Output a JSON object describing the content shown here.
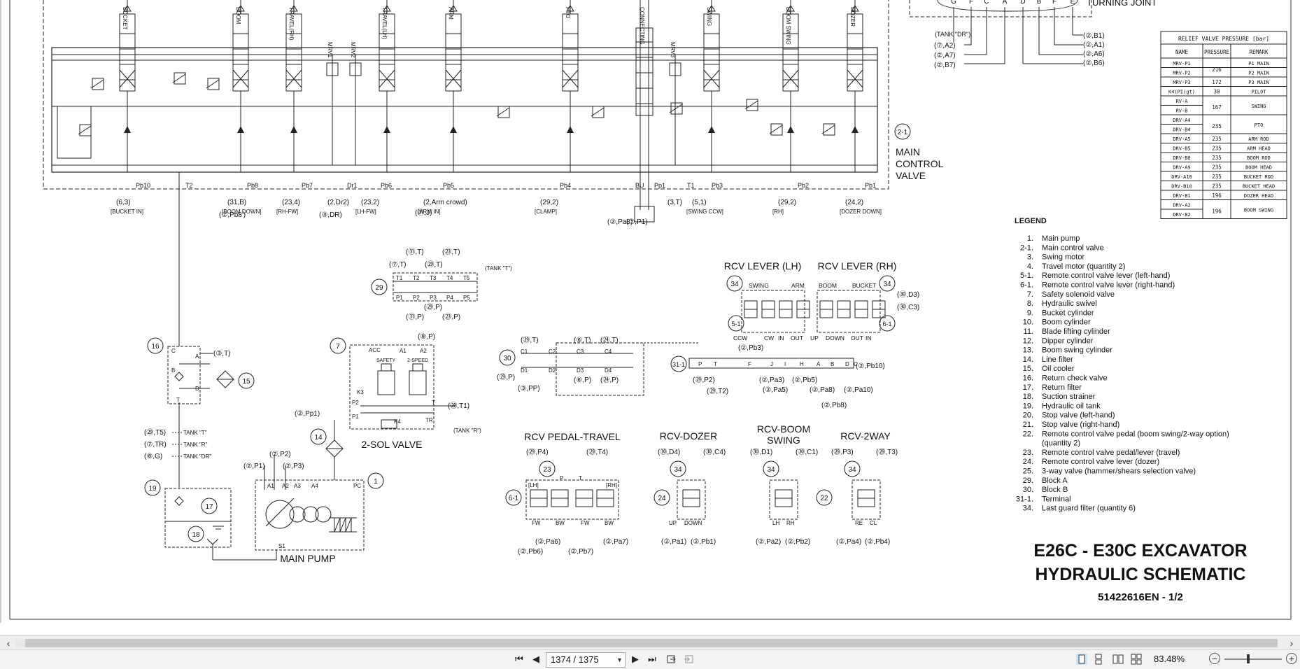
{
  "document": {
    "title_line1": "E26C - E30C EXCAVATOR",
    "title_line2": "HYDRAULIC SCHEMATIC",
    "doc_code": "51422616EN - 1/2"
  },
  "section_labels": {
    "main_control_valve_num": "2-1",
    "main_control_valve_1": "MAIN",
    "main_control_valve_2": "CONTROL",
    "main_control_valve_3": "VALVE",
    "turning_joint": "TURNING JOINT",
    "tank_dr": "(TANK \"DR\")",
    "rcv_lever_lh": "RCV LEVER (LH)",
    "rcv_lever_rh": "RCV LEVER (RH)",
    "rcv_pedal_travel": "RCV PEDAL-TRAVEL",
    "rcv_dozer": "RCV-DOZER",
    "rcv_boom_swing_1": "RCV-BOOM",
    "rcv_boom_swing_2": "SWING",
    "rcv_2way": "RCV-2WAY",
    "sol_valve": "2-SOL VALVE",
    "main_pump": "MAIN PUMP",
    "tank_t": "TANK \"T\"",
    "tank_r": "TANK \"R\"",
    "tank_dr2": "TANK \"DR\"",
    "tank_t_paren": "(TANK \"T\")",
    "tank_r_paren": "(TANK \"R\")",
    "safety": "SAFETY",
    "two_speed": "2-SPEED",
    "acc": "ACC"
  },
  "valve_sections": [
    "BUCKET",
    "BOOM",
    "TRAVEL(RH)",
    "MRV1",
    "MRV2",
    "TRAVEL(LH)",
    "ARM",
    "PTO",
    "CONNECTING",
    "MRV3",
    "SWING",
    "BOOM SWING",
    "DOZER"
  ],
  "ports_bottom": [
    {
      "port": "Pb10",
      "ref": "6",
      "n": "3",
      "desc": "[BUCKET IN]"
    },
    {
      "port": "T2",
      "ref": "",
      "n": "",
      "desc": ""
    },
    {
      "port": "Pb8",
      "ref": "31",
      "n": "B",
      "desc": "[BOOM DOWN]",
      "extra": "(②,Pb8')"
    },
    {
      "port": "Pb7",
      "ref": "23",
      "n": "4",
      "desc": "[RH-FW]"
    },
    {
      "port": "Dr1",
      "ref": "2",
      "n": "Dr2",
      "desc": "",
      "extra": "(③,DR)"
    },
    {
      "port": "Pb6",
      "ref": "23",
      "n": "2",
      "desc": "[LH-FW]"
    },
    {
      "port": "Pb5",
      "ref": "2",
      "n": "Arm crowd",
      "desc": "[ARM IN]",
      "extra": "(㉛,J)"
    },
    {
      "port": "Pb4",
      "ref": "29",
      "n": "2",
      "desc": "[CLAMP]"
    },
    {
      "port": "BU",
      "ref": "",
      "n": "",
      "desc": "",
      "extra": "(②,Pa8)"
    },
    {
      "port": "Pp1",
      "ref": "",
      "n": "",
      "desc": "",
      "extra": "(⑦,P1)"
    },
    {
      "port": "T1",
      "ref": "3",
      "n": "T",
      "desc": ""
    },
    {
      "port": "Pb3",
      "ref": "5",
      "n": "1",
      "desc": "[SWING CCW]"
    },
    {
      "port": "Pb2",
      "ref": "29",
      "n": "2",
      "desc": "[RH]"
    },
    {
      "port": "Pb1",
      "ref": "24",
      "n": "2",
      "desc": "[DOZER DOWN]"
    }
  ],
  "relief_table": {
    "title": "RELIEF VALVE PRESSURE [bar]",
    "headers": [
      "NAME",
      "PRESSURE",
      "REMARK"
    ],
    "rows": [
      {
        "name": "MRV-P1",
        "pressure": "216",
        "remark": "P1 MAIN"
      },
      {
        "name": "MRV-P2",
        "pressure": "",
        "remark": "P2 MAIN"
      },
      {
        "name": "MRV-P3",
        "pressure": "172",
        "remark": "P3 MAIN"
      },
      {
        "name": "K4(PI(gt)",
        "pressure": "30",
        "remark": "PILOT"
      },
      {
        "name": "RV-A",
        "pressure": "167",
        "remark": "SWING"
      },
      {
        "name": "RV-B",
        "pressure": "",
        "remark": ""
      },
      {
        "name": "DRV-A4",
        "pressure": "235",
        "remark": "PTO"
      },
      {
        "name": "DRV-B4",
        "pressure": "",
        "remark": ""
      },
      {
        "name": "DRV-A5",
        "pressure": "235",
        "remark": "ARM ROD"
      },
      {
        "name": "DRV-B5",
        "pressure": "235",
        "remark": "ARM HEAD"
      },
      {
        "name": "DRV-B8",
        "pressure": "235",
        "remark": "BOOM ROD"
      },
      {
        "name": "DRV-A9",
        "pressure": "235",
        "remark": "BOOM HEAD"
      },
      {
        "name": "DRV-A10",
        "pressure": "235",
        "remark": "BUCKET ROD"
      },
      {
        "name": "DRV-B10",
        "pressure": "235",
        "remark": "BUCKET HEAD"
      },
      {
        "name": "DRV-B1",
        "pressure": "196",
        "remark": "DOZER HEAD"
      },
      {
        "name": "DRV-A2",
        "pressure": "196",
        "remark": "BOOM SWING"
      },
      {
        "name": "DRV-B2",
        "pressure": "",
        "remark": ""
      }
    ]
  },
  "legend": {
    "title": "LEGEND",
    "items": [
      {
        "num": "1.",
        "text": "Main pump"
      },
      {
        "num": "2-1.",
        "text": "Main control valve"
      },
      {
        "num": "3.",
        "text": "Swing motor"
      },
      {
        "num": "4.",
        "text": "Travel motor (quantity 2)"
      },
      {
        "num": "5-1.",
        "text": "Remote control valve lever (left-hand)"
      },
      {
        "num": "6-1.",
        "text": "Remote control valve lever (right-hand)"
      },
      {
        "num": "7.",
        "text": "Safety solenoid valve"
      },
      {
        "num": "8.",
        "text": "Hydraulic swivel"
      },
      {
        "num": "9.",
        "text": "Bucket cylinder"
      },
      {
        "num": "10.",
        "text": "Boom cylinder"
      },
      {
        "num": "11.",
        "text": "Blade lifting cylinder"
      },
      {
        "num": "12.",
        "text": "Dipper cylinder"
      },
      {
        "num": "13.",
        "text": "Boom swing cylinder"
      },
      {
        "num": "14.",
        "text": "Line filter"
      },
      {
        "num": "15.",
        "text": "Oil cooler"
      },
      {
        "num": "16.",
        "text": "Return check valve"
      },
      {
        "num": "17.",
        "text": "Return filter"
      },
      {
        "num": "18.",
        "text": "Suction strainer"
      },
      {
        "num": "19.",
        "text": "Hydraulic oil tank"
      },
      {
        "num": "20.",
        "text": "Stop valve (left-hand)"
      },
      {
        "num": "21.",
        "text": "Stop valve (right-hand)"
      },
      {
        "num": "22.",
        "text": "Remote control valve pedal (boom swing/2-way option)"
      },
      {
        "num": "",
        "text": "(quantity 2)"
      },
      {
        "num": "23.",
        "text": "Remote control valve pedal/lever (travel)"
      },
      {
        "num": "24.",
        "text": "Remote control valve lever (dozer)"
      },
      {
        "num": "25.",
        "text": "3-way valve (hammer/shears selection valve)"
      },
      {
        "num": "29.",
        "text": "Block A"
      },
      {
        "num": "30.",
        "text": "Block B"
      },
      {
        "num": "31-1.",
        "text": "Terminal"
      },
      {
        "num": "34.",
        "text": "Last guard filter (quantity 6)"
      }
    ]
  },
  "turning_joint_ports": [
    "G",
    "F",
    "C",
    "A",
    "D",
    "B",
    "F",
    "E"
  ],
  "turning_joint_left": [
    "(⑦,A2)",
    "(②,A7)",
    "(②,B7)"
  ],
  "turning_joint_right": [
    "(②,B1)",
    "(②,A1)",
    "(②,A6)",
    "(②,B6)"
  ],
  "component_numbers": [
    "29",
    "7",
    "16",
    "15",
    "14",
    "19",
    "17",
    "18",
    "1",
    "30",
    "31-1",
    "5-1",
    "6-1",
    "34",
    "23",
    "24",
    "22",
    "34",
    "34",
    "34",
    "34",
    "34"
  ],
  "misc_labels": {
    "pump_ports": [
      "A1",
      "A2",
      "A3",
      "A4",
      "PC",
      "S1"
    ],
    "pump_refs": [
      "(②,P1)",
      "(②,P2)",
      "(②,P3)"
    ],
    "sol_refs": [
      "(⑧,P)",
      "(②,Pp1)",
      "(㉙,T1)"
    ],
    "sol_ports": [
      "A1",
      "A2",
      "K3",
      "P2",
      "P1",
      "K4",
      "TR",
      "T"
    ],
    "block_a_refs": [
      "(㉛,T)",
      "(㉓,T)",
      "(⑦,T)",
      "(㉙,T)",
      "(㉙,P)",
      "(㉛,P)",
      "(㉓,P)"
    ],
    "block_a_ports": [
      "T1",
      "T2",
      "T3",
      "T4",
      "T5",
      "P1",
      "P2",
      "P3",
      "P4",
      "P5"
    ],
    "filter_refs": [
      "(③,T)"
    ],
    "filter_ports": [
      "C",
      "A",
      "B",
      "D",
      "T"
    ],
    "tank_refs": [
      "(㉙,T5)",
      "(⑦,TR)",
      "(⑧,G)"
    ],
    "block_b_ports": [
      "C1",
      "C2",
      "C3",
      "C4",
      "D1",
      "D2",
      "D3",
      "D4"
    ],
    "block_b_refs": [
      "(㉙,T)",
      "(⑥,T)",
      "(㉔,T)",
      "(㉙,P)",
      "(③,PP)",
      "(⑥,P)",
      "(㉔,P)"
    ],
    "rcv_lh_labels": [
      "SWING",
      "ARM",
      "CCW",
      "CW",
      "IN",
      "OUT",
      "(②,Pb3)"
    ],
    "rcv_rh_labels": [
      "BOOM",
      "BUCKET",
      "UP",
      "DOWN",
      "OUT",
      "IN",
      "(㉚,D3)",
      "(㉚,C3)"
    ],
    "terminal_ports": [
      "P",
      "T",
      "F",
      "J",
      "I",
      "H",
      "A",
      "B",
      "D",
      "C"
    ],
    "terminal_refs": [
      "(㉙,P2)",
      "(㉙,T2)",
      "(②,Pa3)",
      "(②,Pa5)",
      "(②,Pb5)",
      "(②,Pa8)",
      "(②,Pa10)",
      "(②,Pb10)",
      "(②,Pb8)"
    ],
    "pedal_refs": [
      "(㉙,P4)",
      "(㉙,T4)",
      "(②,Pa6)",
      "(②,Pb6)",
      "(②,Pb7)",
      "(②,Pa7)"
    ],
    "pedal_labels": [
      "[LH]",
      "[RH]",
      "FW",
      "BW",
      "FW",
      "BW",
      "P",
      "T"
    ],
    "dozer_refs": [
      "(㉚,D4)",
      "(㉚,C4)",
      "(②,Pa1)",
      "(②,Pb1)"
    ],
    "dozer_labels": [
      "UP",
      "DOWN"
    ],
    "boomswing_refs": [
      "(㉚,D1)",
      "(㉚,C1)",
      "(②,Pa2)",
      "(②,Pb2)"
    ],
    "boomswing_labels": [
      "LH",
      "RH"
    ],
    "twoway_refs": [
      "(㉙,P3)",
      "(㉙,T3)",
      "(②,Pa4)",
      "(②,Pb4)"
    ],
    "twoway_labels": [
      "RE",
      "CL"
    ]
  },
  "statusbar": {
    "page_value": "1374 / 1375",
    "zoom": "83.48%"
  }
}
